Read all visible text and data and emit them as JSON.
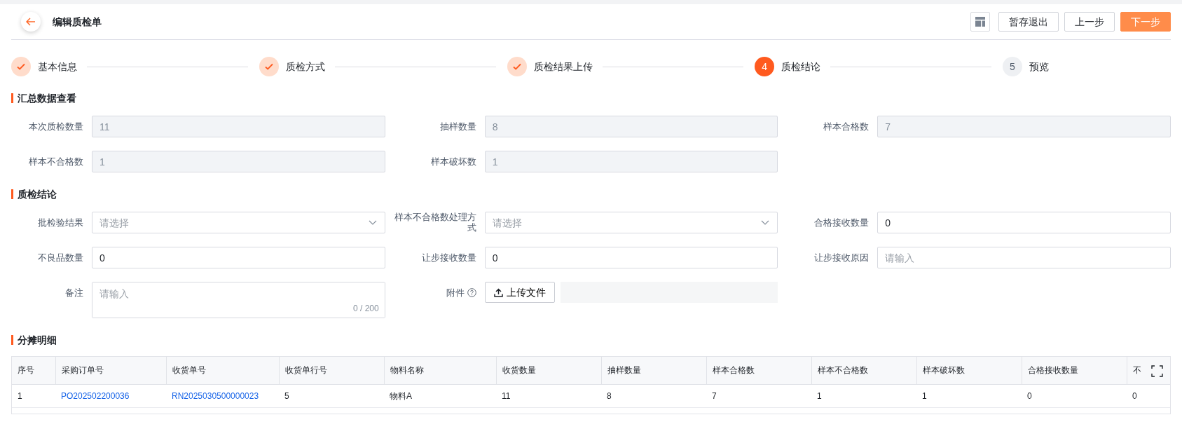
{
  "header": {
    "title": "编辑质检单",
    "buttons": [
      {
        "label": "暂存退出",
        "kind": "default"
      },
      {
        "label": "上一步",
        "kind": "default"
      },
      {
        "label": "下一步",
        "kind": "primary"
      }
    ]
  },
  "steps": [
    {
      "label": "基本信息",
      "completed": true,
      "selected": false
    },
    {
      "label": "质检方式",
      "completed": true,
      "selected": false
    },
    {
      "label": "质检结果上传",
      "completed": true,
      "selected": false
    },
    {
      "number": "4",
      "label": "质检结论",
      "completed": false,
      "selected": true
    },
    {
      "number": "5",
      "label": "预览",
      "completed": false,
      "selected": false
    }
  ],
  "sections": [
    {
      "title": "汇总数据查看",
      "fields": [
        {
          "label": "本次质检数量",
          "kind": "readonly",
          "value": "11"
        },
        {
          "label": "抽样数量",
          "kind": "readonly",
          "value": "8"
        },
        {
          "label": "样本合格数",
          "kind": "readonly",
          "value": "7"
        },
        {
          "label": "样本不合格数",
          "kind": "readonly",
          "value": "1"
        },
        {
          "label": "样本破坏数",
          "kind": "readonly",
          "value": "1"
        }
      ]
    },
    {
      "title": "质检结论",
      "fields": [
        {
          "label": "批检验结果",
          "kind": "select",
          "placeholder": "请选择"
        },
        {
          "label": "样本不合格数处理方式",
          "kind": "select",
          "placeholder": "请选择"
        },
        {
          "label": "合格接收数量",
          "kind": "input",
          "value": "0"
        },
        {
          "label": "不良品数量",
          "kind": "input",
          "value": "0"
        },
        {
          "label": "让步接收数量",
          "kind": "input",
          "value": "0"
        },
        {
          "label": "让步接收原因",
          "kind": "input",
          "placeholder": "请输入"
        },
        {
          "label": "备注",
          "kind": "textarea",
          "placeholder": "请输入",
          "counter": "0 / 200"
        },
        {
          "label": "附件",
          "kind": "upload",
          "button": "上传文件"
        }
      ]
    }
  ],
  "table": {
    "title": "分摊明细",
    "columns": [
      {
        "label": "序号",
        "kind": "text"
      },
      {
        "label": "采购订单号",
        "kind": "link"
      },
      {
        "label": "收货单号",
        "kind": "link"
      },
      {
        "label": "收货单行号",
        "kind": "text"
      },
      {
        "label": "物料名称",
        "kind": "text"
      },
      {
        "label": "收货数量",
        "kind": "text"
      },
      {
        "label": "抽样数量",
        "kind": "text"
      },
      {
        "label": "样本合格数",
        "kind": "text"
      },
      {
        "label": "样本不合格数",
        "kind": "text"
      },
      {
        "label": "样本破坏数",
        "kind": "text"
      },
      {
        "label": "合格接收数量",
        "kind": "text"
      },
      {
        "label": "不",
        "kind": "text"
      }
    ],
    "rows": [
      [
        "1",
        "PO202502200036",
        "RN2025030500000023",
        "5",
        "物料A",
        "11",
        "8",
        "7",
        "1",
        "1",
        "0",
        "0"
      ]
    ]
  }
}
